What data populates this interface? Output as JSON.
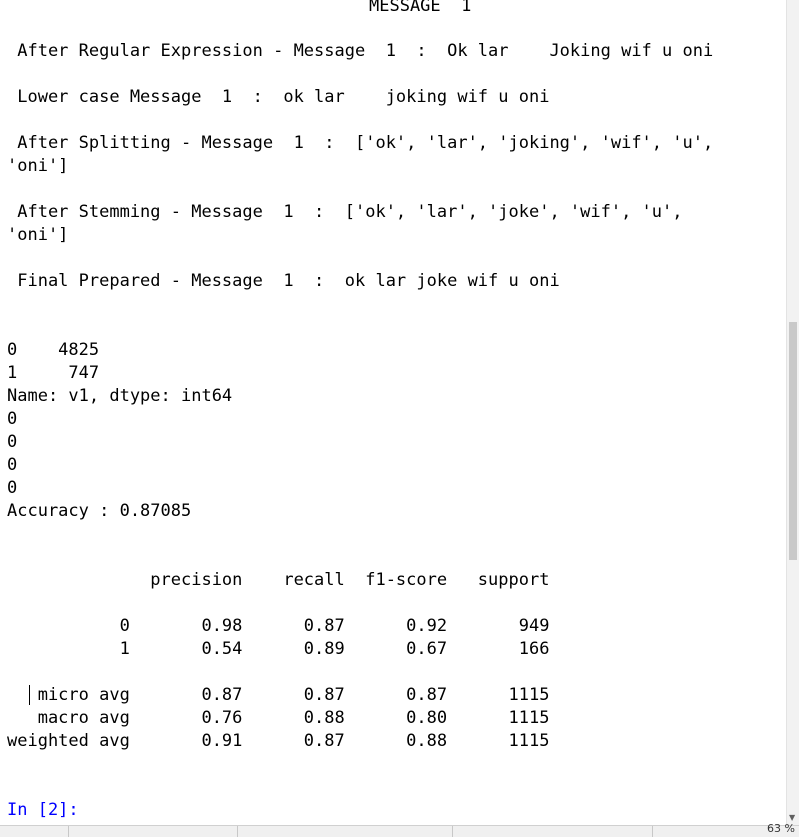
{
  "console": {
    "header": "MESSAGE  1",
    "regex_line": " After Regular Expression - Message  1  :  Ok lar    Joking wif u oni",
    "lower_line": " Lower case Message  1  :  ok lar    joking wif u oni",
    "split_line_1": " After Splitting - Message  1  :  ['ok', 'lar', 'joking', 'wif', 'u',",
    "split_line_2": "'oni']",
    "stem_line_1": " After Stemming - Message  1  :  ['ok', 'lar', 'joke', 'wif', 'u',",
    "stem_line_2": "'oni']",
    "final_line": " Final Prepared - Message  1  :  ok lar joke wif u oni",
    "value_counts": [
      "0    4825",
      "1     747",
      "Name: v1, dtype: int64"
    ],
    "zeros": [
      "0",
      "0",
      "0",
      "0"
    ],
    "accuracy_line": "Accuracy : 0.87085",
    "report_header": "              precision    recall  f1-score   support",
    "report_rows": [
      "           0       0.98      0.87      0.92       949",
      "           1       0.54      0.89      0.67       166",
      "   micro avg       0.87      0.87      0.87      1115",
      "   macro avg       0.76      0.88      0.80      1115",
      "weighted avg       0.91      0.87      0.88      1115"
    ],
    "prompt": "In [2]:"
  },
  "statusbar": {
    "zoom": "63 %"
  }
}
